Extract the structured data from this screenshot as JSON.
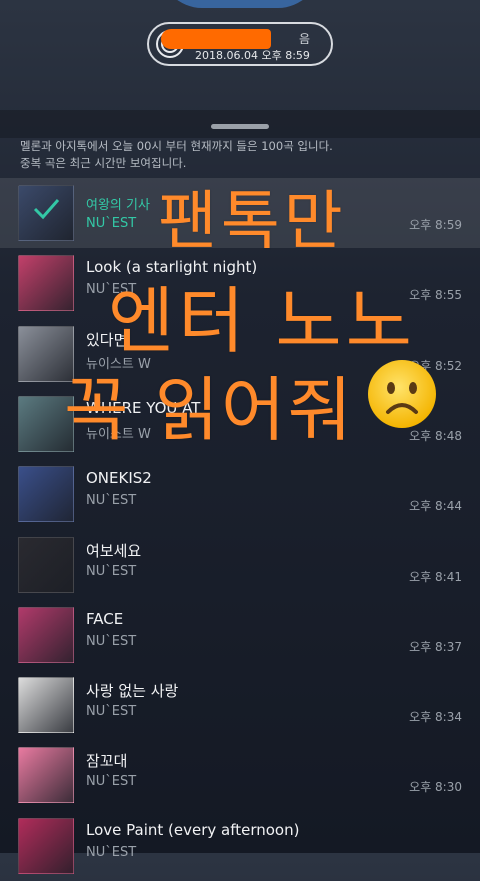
{
  "header": {
    "title_tail": "음",
    "date_time": "2018.06.04 오후 8:59"
  },
  "notice": {
    "line1": "멜론과 아지톡에서 오늘 00시 부터 현재까지 들은 100곡 입니다.",
    "line2": "중복 곡은 최근 시간만 보여집니다."
  },
  "songs": [
    {
      "title": "여왕의 기사",
      "artist": "NU`EST",
      "time": "오후 8:59",
      "selected": true,
      "art": "#3b4a6a"
    },
    {
      "title": "Look (a starlight night)",
      "artist": "NU`EST",
      "time": "오후 8:55",
      "art": "#c2406a"
    },
    {
      "title": "있다면",
      "artist": "뉴이스트 W",
      "time": "오후 8:52",
      "art": "#8a8f99"
    },
    {
      "title": "WHERE YOU AT",
      "artist": "뉴이스트 W",
      "time": "오후 8:48",
      "art": "#5b7a80"
    },
    {
      "title": "ONEKIS2",
      "artist": "NU`EST",
      "time": "오후 8:44",
      "art": "#3a4f8a"
    },
    {
      "title": "여보세요",
      "artist": "NU`EST",
      "time": "오후 8:41",
      "art": "#2a2a30"
    },
    {
      "title": "FACE",
      "artist": "NU`EST",
      "time": "오후 8:37",
      "art": "#b03a6a"
    },
    {
      "title": "사랑 없는 사랑",
      "artist": "NU`EST",
      "time": "오후 8:34",
      "art": "#dcdcdc"
    },
    {
      "title": "잠꼬대",
      "artist": "NU`EST",
      "time": "오후 8:30",
      "art": "#e87aa0"
    },
    {
      "title": "Love Paint (every afternoon)",
      "artist": "NU`EST",
      "time": "",
      "art": "#b02c5a"
    }
  ],
  "overlay": {
    "line1": "팬톡만",
    "line2": "엔터 노노",
    "line3": "꼭 읽어줘",
    "color": "#ff8a2b"
  },
  "colors": {
    "accent": "#33c8a6",
    "redaction": "#ff6a00"
  }
}
